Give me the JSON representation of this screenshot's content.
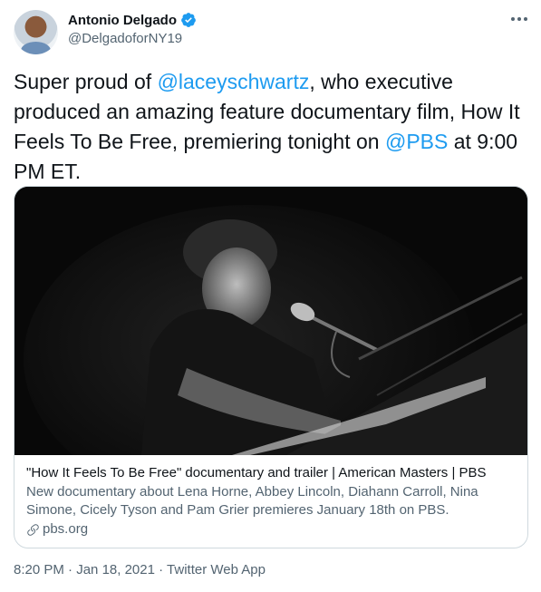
{
  "author": {
    "display_name": "Antonio Delgado",
    "handle": "@DelgadoforNY19",
    "verified": true
  },
  "tweet": {
    "text_parts": [
      {
        "text": "Super proud of ",
        "type": "plain"
      },
      {
        "text": "@laceyschwartz",
        "type": "mention"
      },
      {
        "text": ", who executive produced an amazing feature documentary film, How It Feels To Be Free, premiering tonight on ",
        "type": "plain"
      },
      {
        "text": "@PBS",
        "type": "mention"
      },
      {
        "text": " at 9:00 PM ET.",
        "type": "plain"
      }
    ]
  },
  "card": {
    "title": "\"How It Feels To Be Free\" documentary and trailer | American Masters | PBS",
    "description": "New documentary about Lena Horne, Abbey Lincoln, Diahann Carroll, Nina Simone, Cicely Tyson and Pam Grier premieres January 18th on PBS.",
    "domain": "pbs.org",
    "link_icon": "link-icon",
    "image_description_icon": "photo"
  },
  "meta": {
    "time": "8:20 PM",
    "separator": " · ",
    "date": "Jan 18, 2021",
    "source": "Twitter Web App"
  },
  "colors": {
    "accent": "#1d9bf0",
    "text": "#0f1419",
    "secondary": "#536471",
    "border": "#cfd9de"
  }
}
